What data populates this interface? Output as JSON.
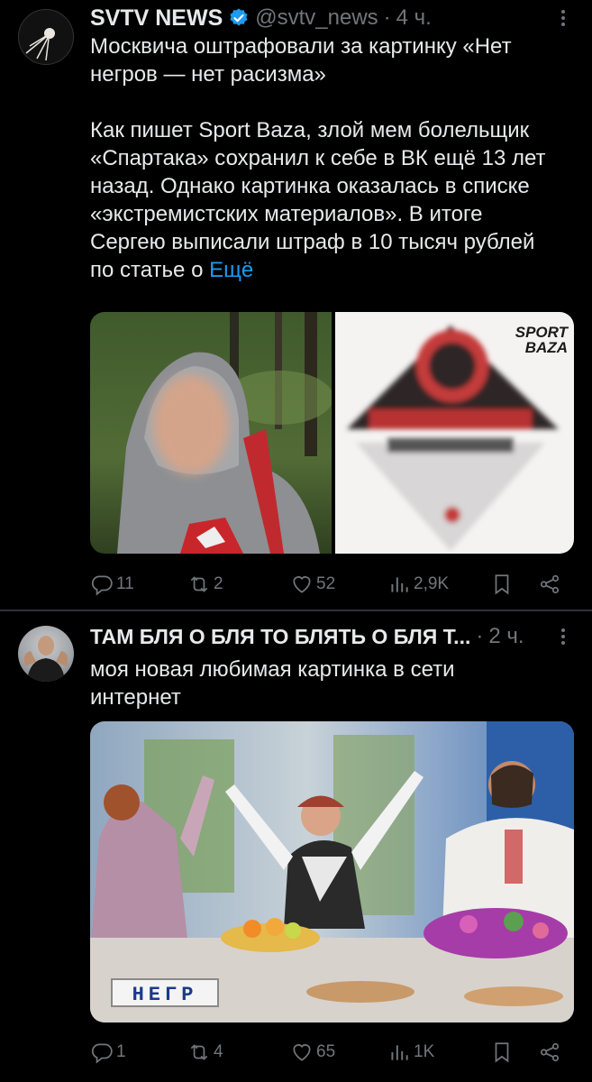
{
  "tweets": [
    {
      "author_name": "SVTV NEWS",
      "handle": "@svtv_news",
      "separator": "·",
      "time": "4 ч.",
      "text_lines": [
        "Москвича оштрафовали за картинку «Нет",
        "негров — нет расизма»",
        "",
        "Как пишет Sport Baza, злой мем болельщик",
        "«Спартака» сохранил к себе в ВК ещё 13 лет",
        "назад. Однако картинка оказалась в списке",
        "«экстремистских материалов». В итоге",
        "Сергею выписали штраф в 10 тысяч рублей"
      ],
      "last_line": "по статье о ",
      "show_more": "Ещё",
      "media_watermark": [
        "SPORT",
        "BAZA"
      ],
      "replies": "11",
      "reposts": "2",
      "likes": "52",
      "views": "2,9K"
    },
    {
      "author_name": "ТАМ БЛЯ О БЛЯ ТО БЛЯТЬ О БЛЯ Т...",
      "separator": "·",
      "time": "2 ч.",
      "text_lines": [
        "моя новая любимая картинка в сети",
        "интернет"
      ],
      "media_caption": "НЕГР",
      "replies": "1",
      "reposts": "4",
      "likes": "65",
      "views": "1K"
    }
  ],
  "colors": {
    "background": "#000000",
    "text": "#e7e9ea",
    "muted": "#71767b",
    "link": "#1d9bf0",
    "verified": "#1d9bf0",
    "divider": "#2f3336"
  },
  "icons": [
    "verified-badge-icon",
    "more-icon",
    "reply-icon",
    "repost-icon",
    "like-icon",
    "views-icon",
    "bookmark-icon",
    "share-icon"
  ]
}
